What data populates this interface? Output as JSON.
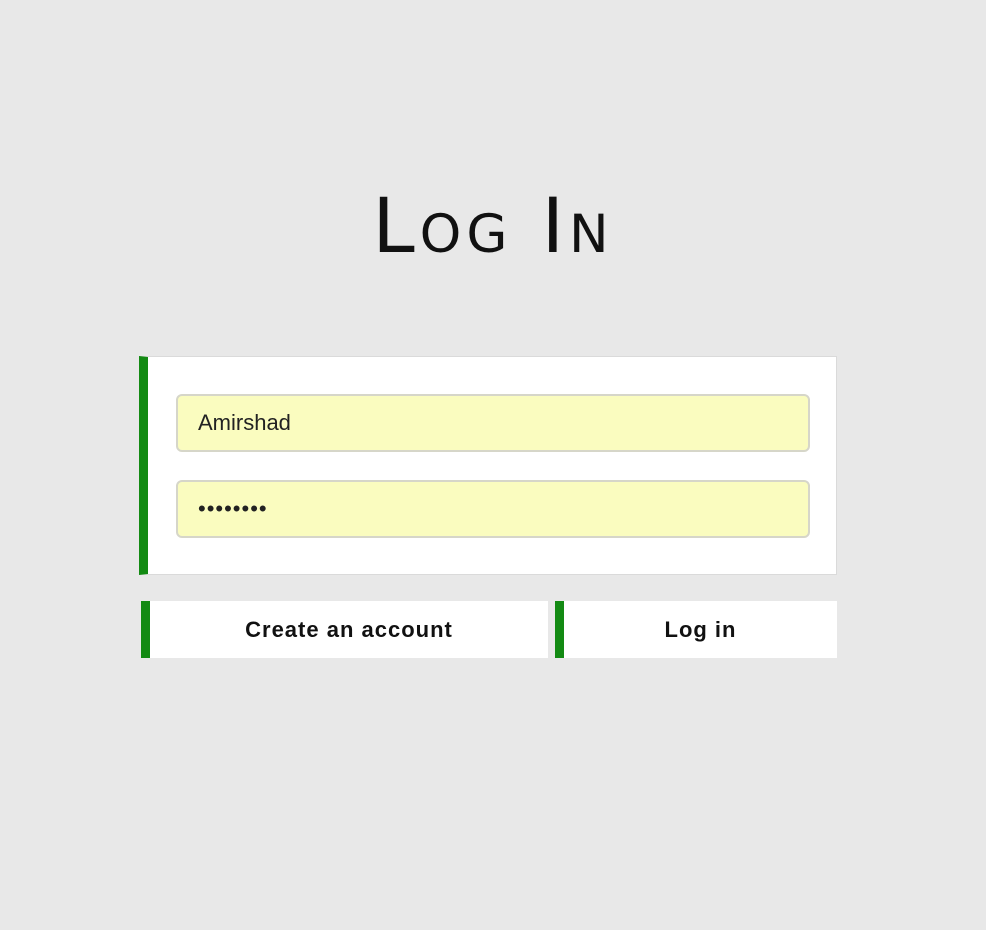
{
  "page": {
    "title": "Log In"
  },
  "form": {
    "username_value": "Amirshad",
    "password_value": "Amirshad"
  },
  "actions": {
    "create_account_label": "Create an account",
    "login_label": "Log in"
  },
  "colors": {
    "background": "#e8e8e8",
    "accent": "#138a13",
    "field_background": "#fafcbf",
    "panel_background": "#ffffff"
  }
}
